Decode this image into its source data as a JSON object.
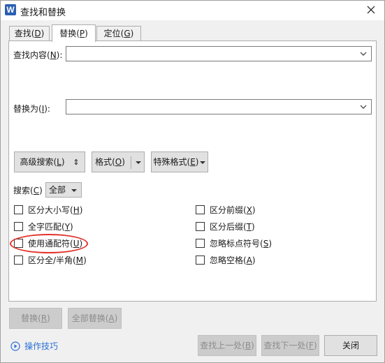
{
  "window": {
    "title": "查找和替换",
    "app_icon_letter": "W",
    "close_icon": "close-icon"
  },
  "tabs": [
    {
      "label_pre": "查找(",
      "hotkey": "D",
      "label_post": ")",
      "active": false
    },
    {
      "label_pre": "替换(",
      "hotkey": "P",
      "label_post": ")",
      "active": true
    },
    {
      "label_pre": "定位(",
      "hotkey": "G",
      "label_post": ")",
      "active": false
    }
  ],
  "find": {
    "label_pre": "查找内容(",
    "hotkey": "N",
    "label_post": "):",
    "value": ""
  },
  "replace": {
    "label_pre": "替换为(",
    "hotkey": "I",
    "label_post": "):",
    "value": ""
  },
  "buttons": {
    "advanced_pre": "高级搜索(",
    "advanced_key": "L",
    "advanced_post": ")",
    "advanced_arrow": "⇕",
    "format_pre": "格式(",
    "format_key": "O",
    "format_post": ")",
    "special_pre": "特殊格式(",
    "special_key": "E",
    "special_post": ")"
  },
  "search": {
    "label_pre": "搜索(",
    "hotkey": "C",
    "label_post": ")",
    "selected": "全部"
  },
  "options_left": [
    {
      "pre": "区分大小写(",
      "key": "H",
      "post": ")",
      "checked": false
    },
    {
      "pre": "全字匹配(",
      "key": "Y",
      "post": ")",
      "checked": false
    },
    {
      "pre": "使用通配符(",
      "key": "U",
      "post": ")",
      "checked": false
    },
    {
      "pre": "区分全/半角(",
      "key": "M",
      "post": ")",
      "checked": false
    }
  ],
  "options_right": [
    {
      "pre": "区分前缀(",
      "key": "X",
      "post": ")",
      "checked": false
    },
    {
      "pre": "区分后缀(",
      "key": "T",
      "post": ")",
      "checked": false
    },
    {
      "pre": "忽略标点符号(",
      "key": "S",
      "post": ")",
      "checked": false
    },
    {
      "pre": "忽略空格(",
      "key": "A",
      "post": ")",
      "checked": false
    }
  ],
  "actions": {
    "replace_pre": "替换(",
    "replace_key": "R",
    "replace_post": ")",
    "replace_all_pre": "全部替换(",
    "replace_all_key": "A",
    "replace_all_post": ")",
    "find_prev_pre": "查找上一处(",
    "find_prev_key": "B",
    "find_prev_post": ")",
    "find_next_pre": "查找下一处(",
    "find_next_key": "F",
    "find_next_post": ")",
    "close": "关闭"
  },
  "tips": {
    "label": "操作技巧"
  },
  "colors": {
    "accent_link": "#2b70d6",
    "highlight_ring": "#e2332b",
    "app_icon": "#2b5fb3"
  }
}
